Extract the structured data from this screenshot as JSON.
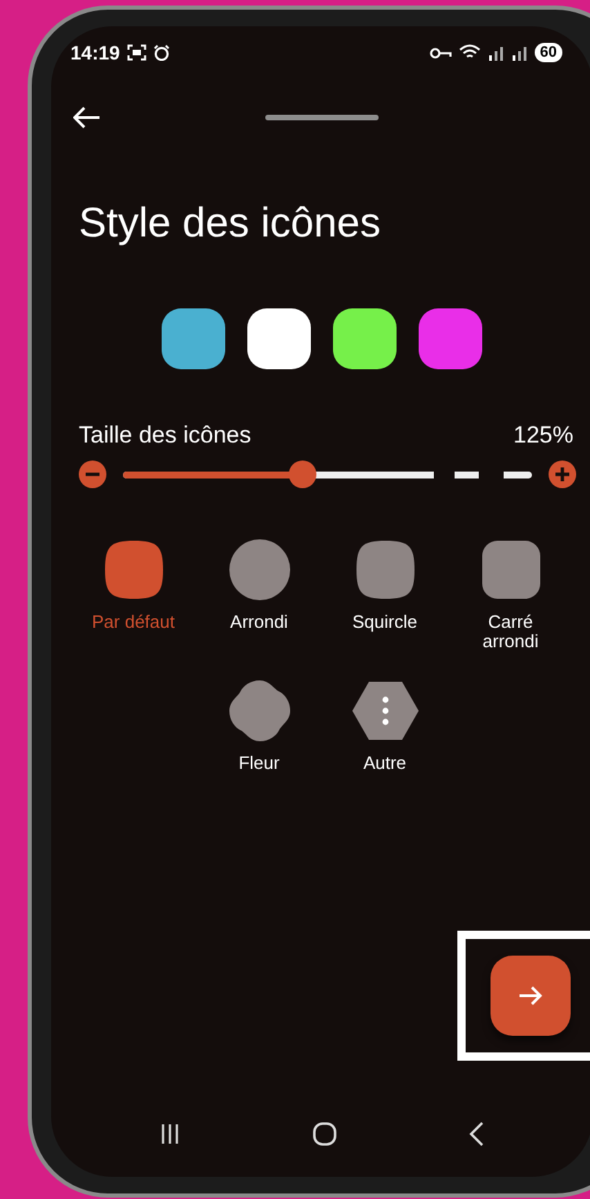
{
  "status_bar": {
    "time": "14:19",
    "battery": "60"
  },
  "header": {
    "title": "Style des icônes"
  },
  "swatches": [
    {
      "color": "#4ab0d0"
    },
    {
      "color": "#ffffff"
    },
    {
      "color": "#76f04a"
    },
    {
      "color": "#e92ee8"
    }
  ],
  "size_slider": {
    "label": "Taille des icônes",
    "reading": "125%",
    "level": 0.44
  },
  "shapes": [
    {
      "kind": "squircle",
      "label": "Par défaut",
      "selected": true
    },
    {
      "kind": "circle",
      "label": "Arrondi",
      "selected": false
    },
    {
      "kind": "squircle",
      "label": "Squircle",
      "selected": false
    },
    {
      "kind": "rounded-square",
      "label": "Carré arrondi",
      "selected": false
    },
    {
      "kind": "flower",
      "label": "Fleur",
      "selected": false
    },
    {
      "kind": "hexagon-more",
      "label": "Autre",
      "selected": false
    }
  ],
  "next_button": {
    "highlighted": true
  }
}
